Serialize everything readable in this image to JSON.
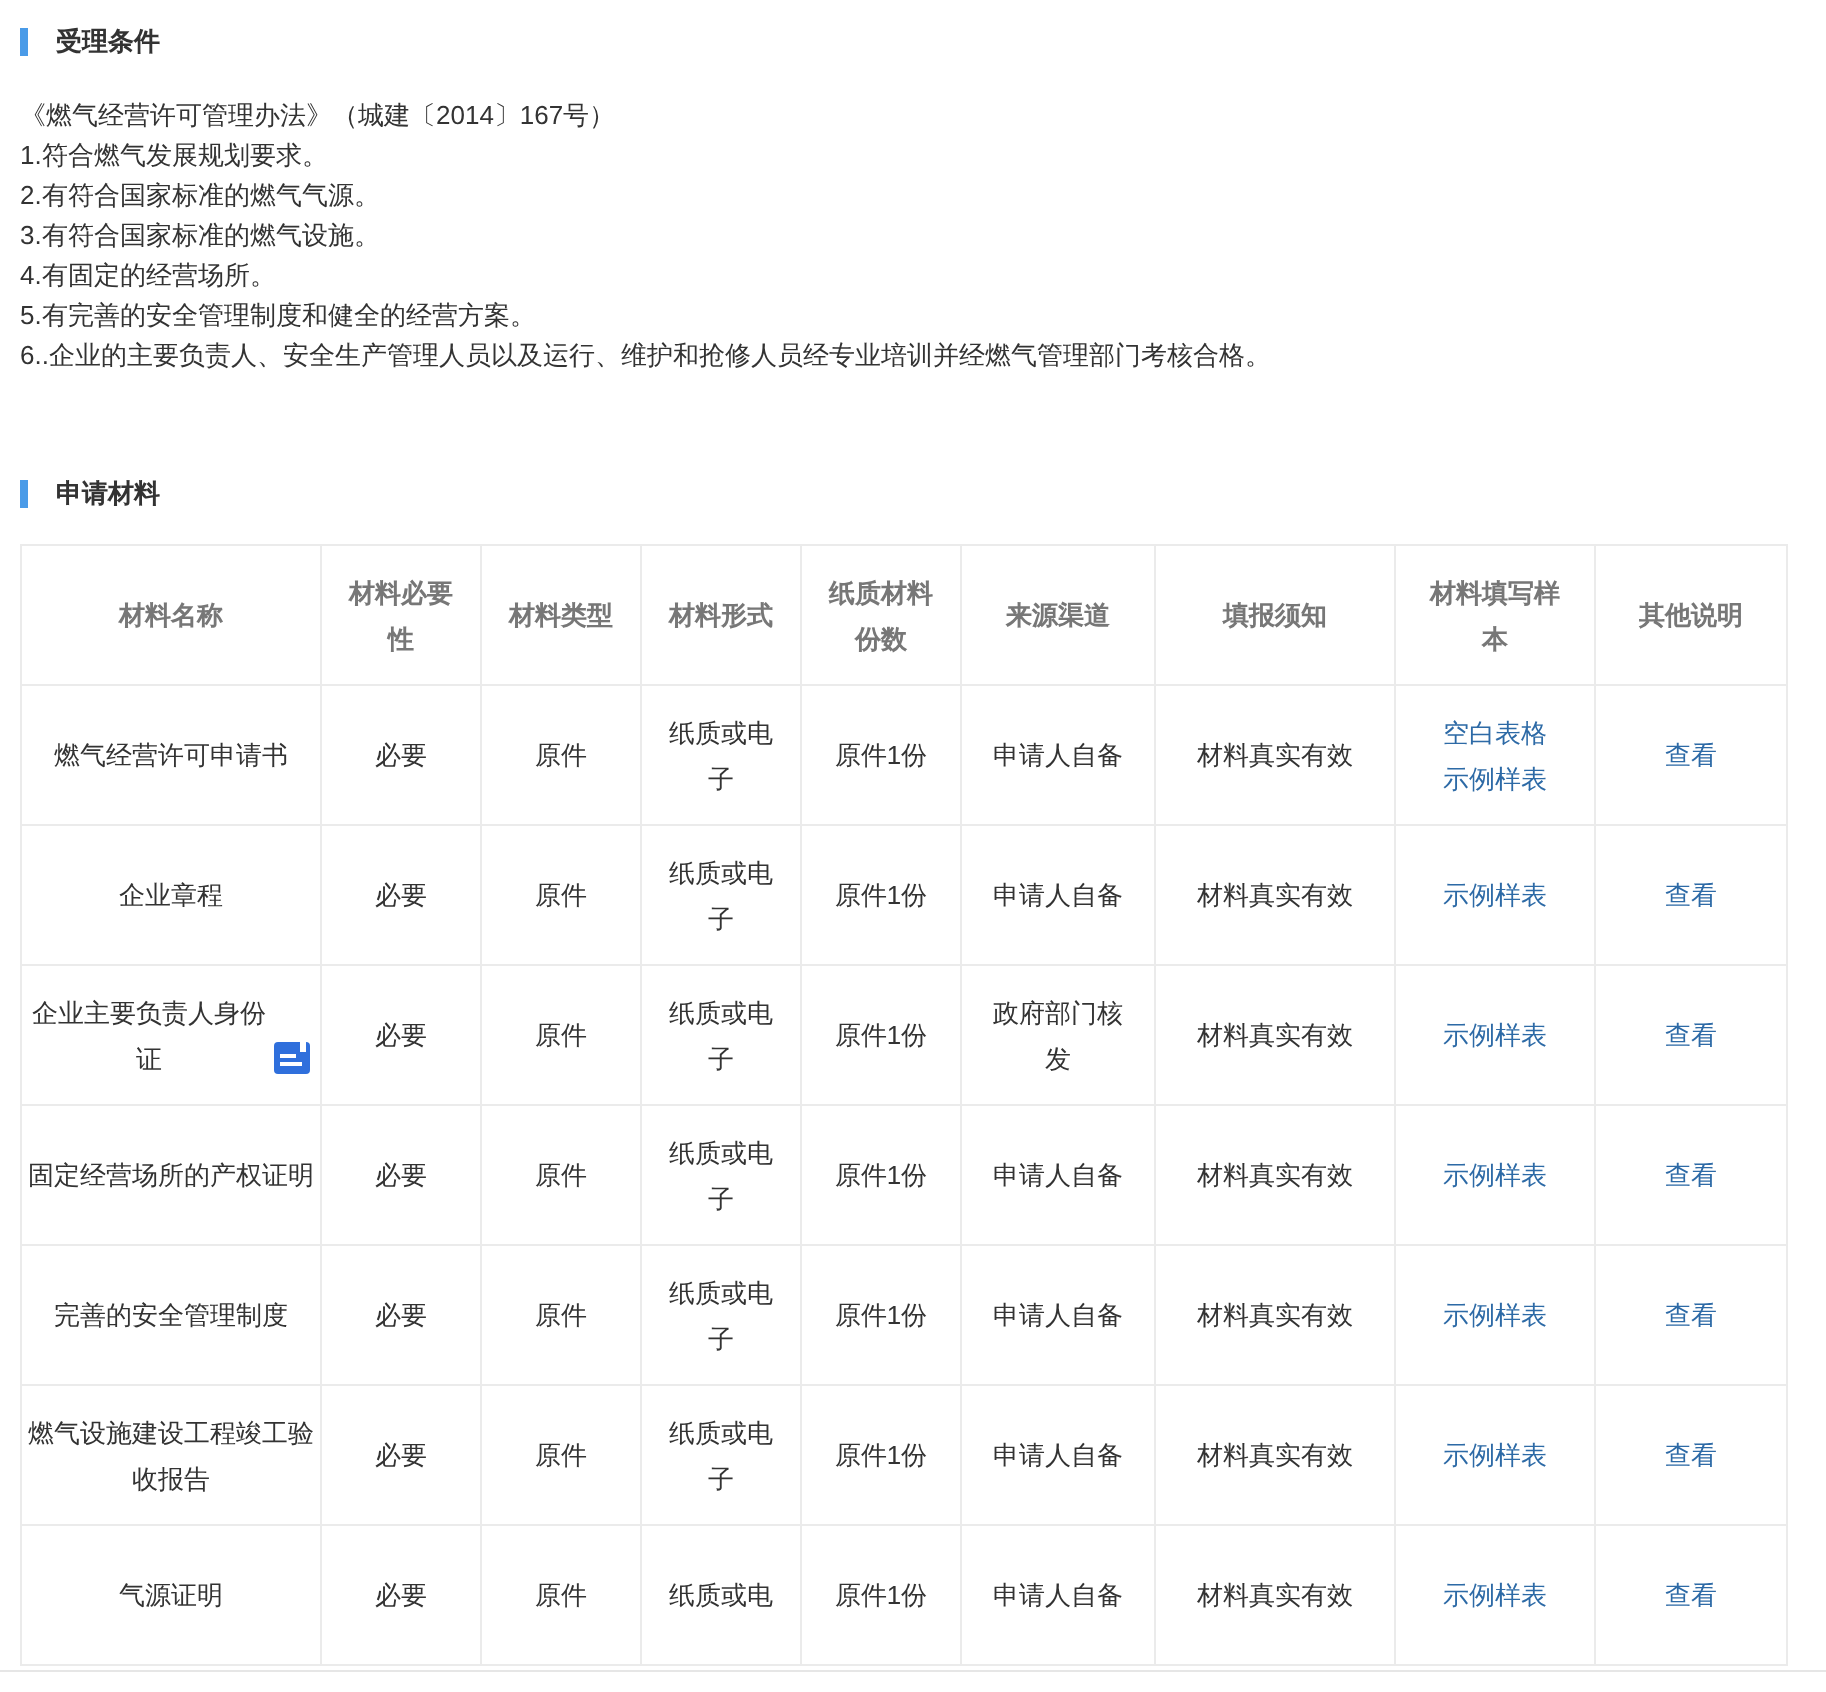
{
  "conditions": {
    "title": "受理条件",
    "lines": [
      "《燃气经营许可管理办法》（城建〔2014〕167号）",
      "1.符合燃气发展规划要求。",
      "2.有符合国家标准的燃气气源。",
      "3.有符合国家标准的燃气设施。",
      "4.有固定的经营场所。",
      "5.有完善的安全管理制度和健全的经营方案。",
      "6..企业的主要负责人、安全生产管理人员以及运行、维护和抢修人员经专业培训并经燃气管理部门考核合格。"
    ]
  },
  "materials": {
    "title": "申请材料",
    "columns": [
      "材料名称",
      "材料必要性",
      "材料类型",
      "材料形式",
      "纸质材料份数",
      "来源渠道",
      "填报须知",
      "材料填写样本",
      "其他说明"
    ],
    "rows": [
      {
        "name": "燃气经营许可申请书",
        "attachment": false,
        "necessity": "必要",
        "type": "原件",
        "form": "纸质或电子",
        "copies": "原件1份",
        "source": "申请人自备",
        "notice": "材料真实有效",
        "samples": [
          "空白表格",
          "示例样表"
        ],
        "other": "查看"
      },
      {
        "name": "企业章程",
        "attachment": false,
        "necessity": "必要",
        "type": "原件",
        "form": "纸质或电子",
        "copies": "原件1份",
        "source": "申请人自备",
        "notice": "材料真实有效",
        "samples": [
          "示例样表"
        ],
        "other": "查看"
      },
      {
        "name": "企业主要负责人身份证",
        "attachment": true,
        "necessity": "必要",
        "type": "原件",
        "form": "纸质或电子",
        "copies": "原件1份",
        "source": "政府部门核发",
        "notice": "材料真实有效",
        "samples": [
          "示例样表"
        ],
        "other": "查看"
      },
      {
        "name": "固定经营场所的产权证明",
        "attachment": false,
        "necessity": "必要",
        "type": "原件",
        "form": "纸质或电子",
        "copies": "原件1份",
        "source": "申请人自备",
        "notice": "材料真实有效",
        "samples": [
          "示例样表"
        ],
        "other": "查看"
      },
      {
        "name": "完善的安全管理制度",
        "attachment": false,
        "necessity": "必要",
        "type": "原件",
        "form": "纸质或电子",
        "copies": "原件1份",
        "source": "申请人自备",
        "notice": "材料真实有效",
        "samples": [
          "示例样表"
        ],
        "other": "查看"
      },
      {
        "name": "燃气设施建设工程竣工验收报告",
        "attachment": false,
        "necessity": "必要",
        "type": "原件",
        "form": "纸质或电子",
        "copies": "原件1份",
        "source": "申请人自备",
        "notice": "材料真实有效",
        "samples": [
          "示例样表"
        ],
        "other": "查看"
      },
      {
        "name": "气源证明",
        "attachment": false,
        "necessity": "必要",
        "type": "原件",
        "form": "纸质或电",
        "copies": "原件1份",
        "source": "申请人自备",
        "notice": "材料真实有效",
        "samples": [
          "示例样表"
        ],
        "other": "查看"
      }
    ]
  }
}
